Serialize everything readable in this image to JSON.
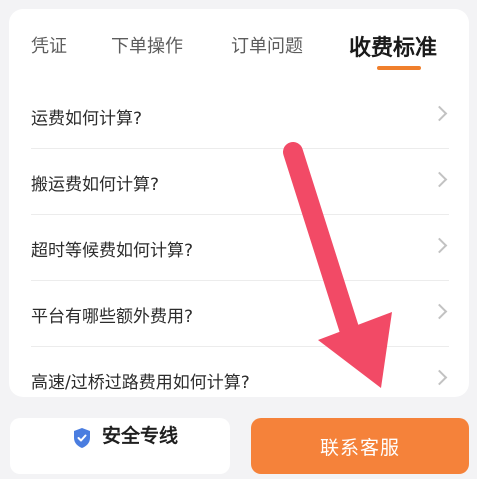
{
  "tabs": [
    {
      "label": "凭证",
      "active": false
    },
    {
      "label": "下单操作",
      "active": false
    },
    {
      "label": "订单问题",
      "active": false
    },
    {
      "label": "收费标准",
      "active": true
    }
  ],
  "faq": [
    {
      "question": "运费如何计算?"
    },
    {
      "question": "搬运费如何计算?"
    },
    {
      "question": "超时等候费如何计算?"
    },
    {
      "question": "平台有哪些额外费用?"
    },
    {
      "question": "高速/过桥过路费用如何计算?"
    }
  ],
  "footer": {
    "safety_label": "安全专线",
    "contact_label": "联系客服"
  },
  "colors": {
    "accent": "#f5823a",
    "arrow": "#f24a66",
    "shield": "#4a7de0"
  },
  "icons": [
    "shield-icon",
    "chevron-right-icon",
    "arrow-annotation"
  ]
}
